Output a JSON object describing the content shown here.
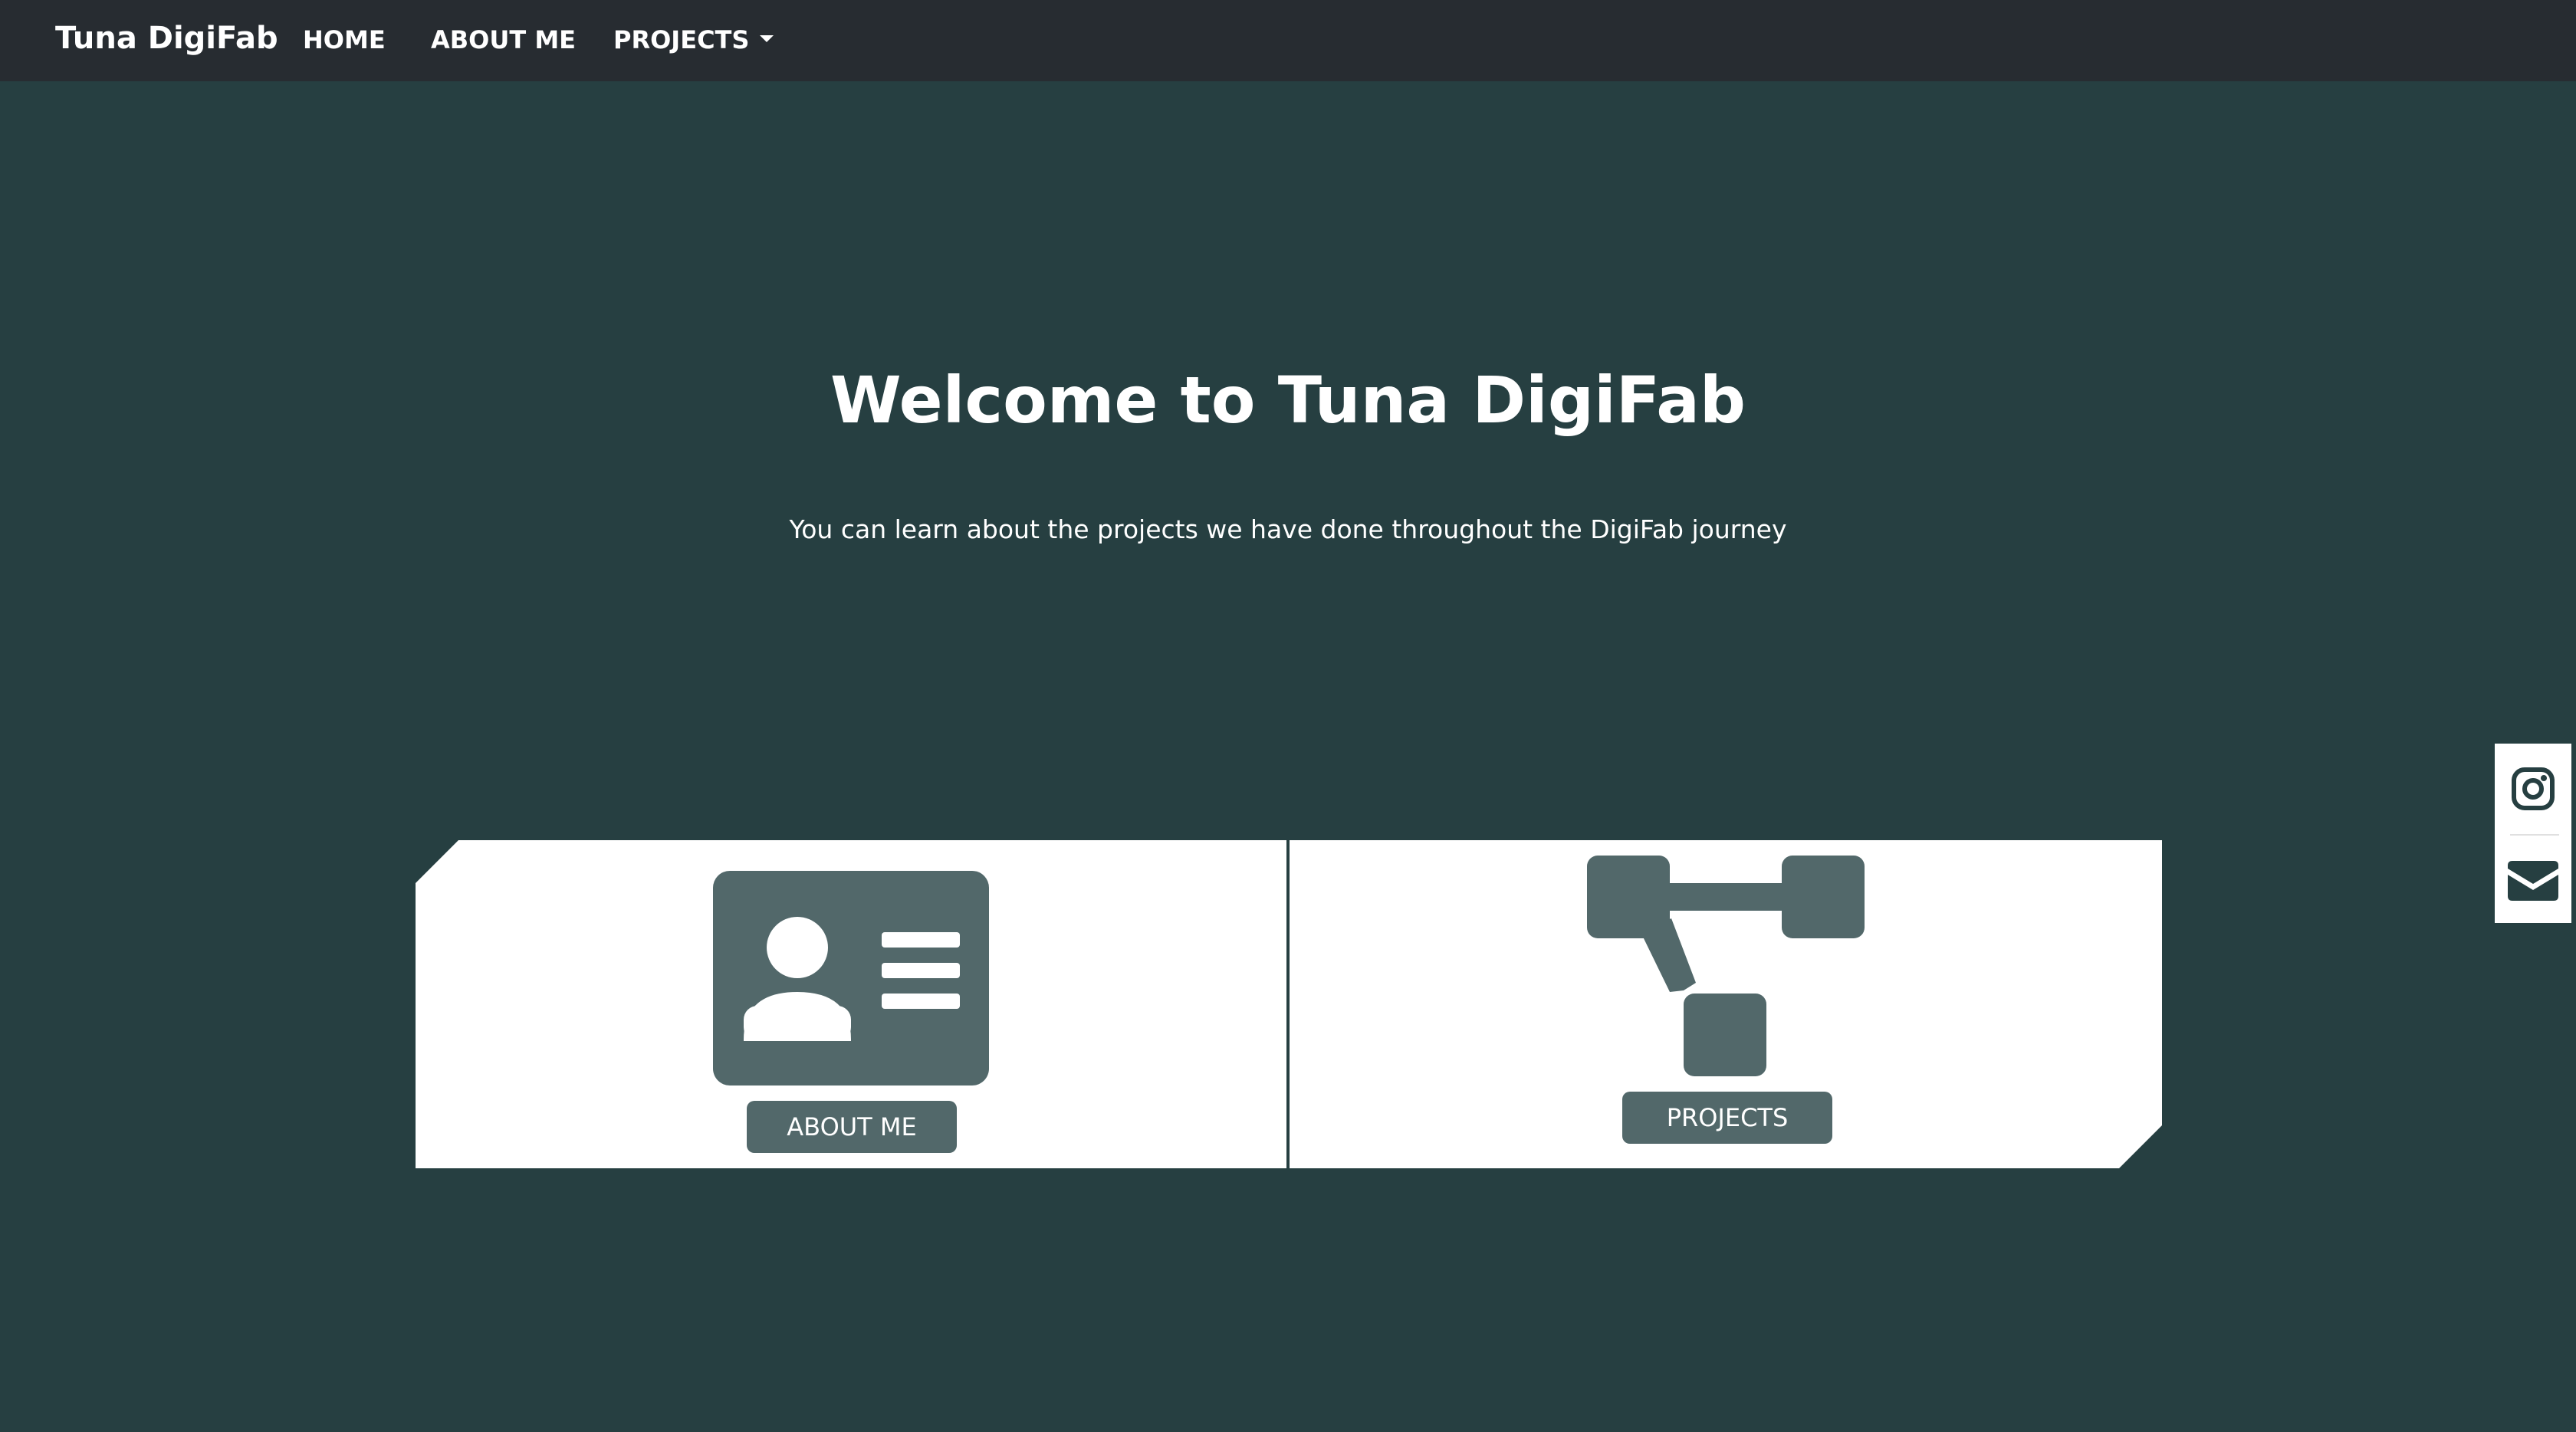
{
  "navbar": {
    "brand": "Tuna DigiFab",
    "links": [
      {
        "label": "HOME"
      },
      {
        "label": "ABOUT ME"
      },
      {
        "label": "PROJECTS",
        "has_dropdown": true
      }
    ]
  },
  "hero": {
    "title": "Welcome to Tuna DigiFab",
    "subtitle": "You can learn about the projects we have done throughout the DigiFab journey"
  },
  "cards": [
    {
      "icon": "id-card-icon",
      "button_label": "ABOUT ME"
    },
    {
      "icon": "robot-arm-icon",
      "button_label": "PROJECTS"
    }
  ],
  "social": [
    {
      "icon": "instagram-icon"
    },
    {
      "icon": "envelope-icon"
    }
  ],
  "colors": {
    "background": "#263f41",
    "navbar": "#272c31",
    "icon_fill": "#52686a",
    "card": "#ffffff"
  }
}
